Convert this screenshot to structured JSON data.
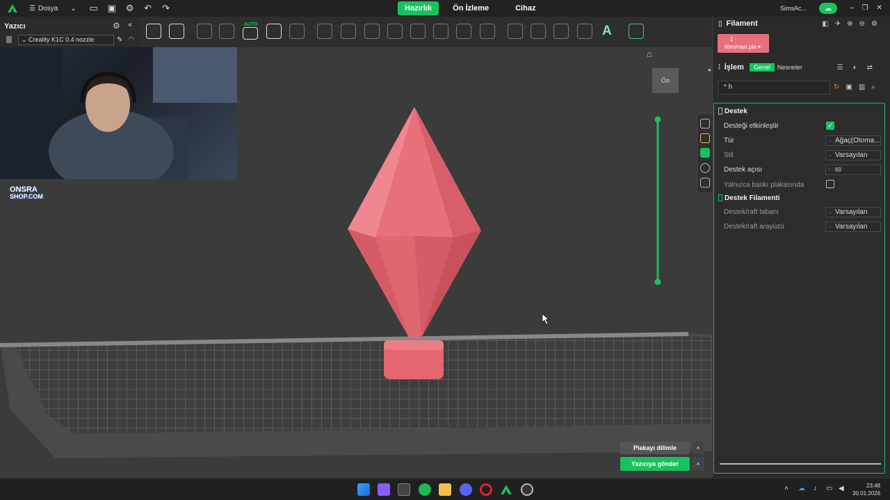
{
  "topbar": {
    "file_menu": "Dosya",
    "tabs": [
      {
        "label": "Hazırlık",
        "active": true
      },
      {
        "label": "Ön İzleme",
        "active": false
      },
      {
        "label": "Cihaz",
        "active": false
      }
    ],
    "user": "SimsAc..."
  },
  "printer_panel": {
    "title": "Yazıcı",
    "printer": "Creality K1C 0.4 nozzle"
  },
  "toolbar": {
    "auto_label": "AUTO"
  },
  "viewport": {
    "view_cube_label": "Ön",
    "shop_logo_line1": "ONSRA",
    "shop_logo_line2": "SHOP.COM",
    "slice_button": "Plakayı dilimle",
    "send_button": "Yazıcıya gönder",
    "model_color": "#e8707a"
  },
  "right_panel": {
    "filament_title": "Filament",
    "filament_slot": "1",
    "filament_name": "fibromast pla",
    "process_title": "İşlem",
    "tab_general": "Genel",
    "tab_objects": "Nesneler",
    "preset_name": "* h",
    "support_section": "Destek",
    "enable_support": "Desteği etkinleştir",
    "type_label": "Tür",
    "type_value": "Ağaç(Otoma...",
    "style_label": "Stil",
    "style_value": "Varsayılan",
    "angle_label": "Destek açısı",
    "angle_value": "60",
    "plate_only_label": "Yalnızca baskı plakasında",
    "filament_section": "Destek Filamenti",
    "base_label": "Destek/raft tabanı",
    "base_value": "Varsayılan",
    "interface_label": "Destek/raft arayüzü",
    "interface_value": "Varsayılan"
  },
  "taskbar": {
    "time": "23:48",
    "date": "30.01.2026"
  },
  "colors": {
    "accent": "#19c15e",
    "background": "#3a3a3a"
  }
}
